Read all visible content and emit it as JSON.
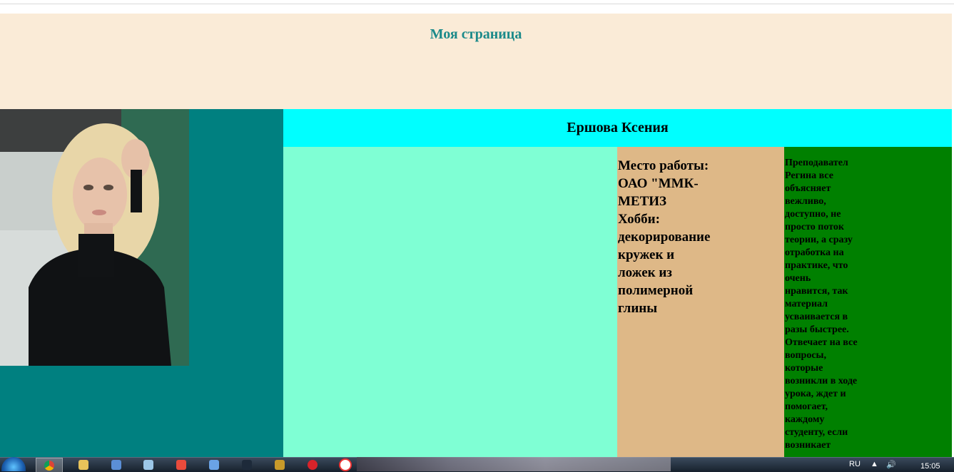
{
  "header": {
    "title": "Моя страница"
  },
  "profile": {
    "name": "Ершова Ксения"
  },
  "info": {
    "lines": [
      "Место работы:",
      "ОАО \"ММК-",
      "МЕТИЗ",
      "Хобби:",
      "декорирование",
      "кружек и",
      "ложек из",
      "полимерной",
      "глины"
    ]
  },
  "review": {
    "lines": [
      "Преподавател",
      "Регина все",
      "объясняет",
      "вежливо,",
      "доступно, не",
      "просто поток",
      "теории, а сразу",
      "отработка на",
      "практике, что",
      "очень",
      "нравится, так",
      "материал",
      "усваивается в",
      "разы быстрее.",
      "Отвечает на все",
      "вопросы,",
      "которые",
      "возникли в ходе",
      "урока, ждет и",
      "помогает,",
      "каждому",
      "студенту, если",
      "возникает"
    ]
  },
  "colors": {
    "header_bg": "#faebd7",
    "title": "#1b8a8a",
    "left_col": "#008080",
    "name_bar": "#00ffff",
    "mint": "#7fffd4",
    "tan": "#deb887",
    "green": "#008000"
  },
  "taskbar": {
    "language": "RU",
    "clock": "15:05",
    "apps": [
      "chrome-icon",
      "folder-icon",
      "media-player-icon",
      "network-icon",
      "yandex-browser-icon",
      "mail-icon",
      "terminal-icon",
      "shield-icon",
      "opera-icon",
      "yandex-icon"
    ]
  }
}
